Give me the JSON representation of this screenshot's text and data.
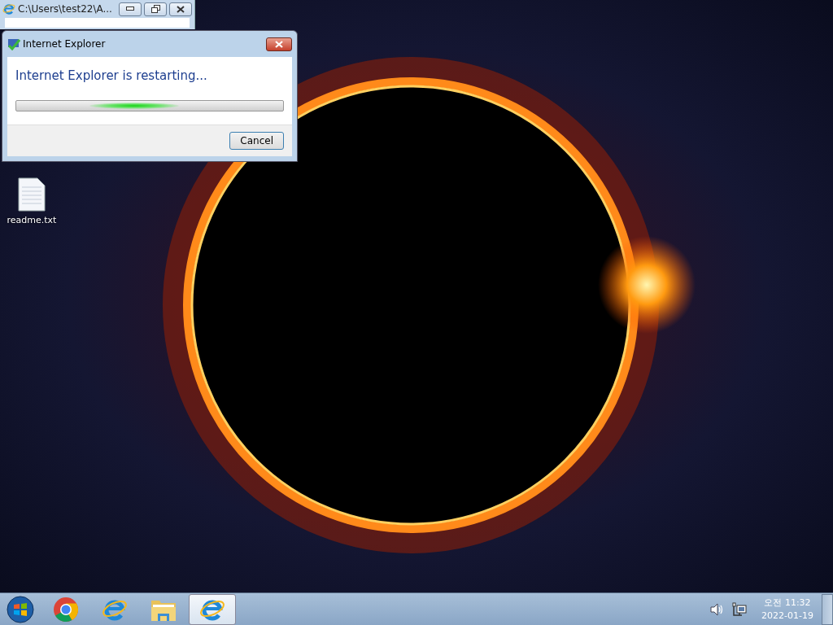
{
  "background_window": {
    "title": "C:\\Users\\test22\\A..."
  },
  "dialog": {
    "title": "Internet Explorer",
    "message": "Internet Explorer is restarting...",
    "indeterminate": true,
    "buttons": [
      "Cancel"
    ]
  },
  "desktop_icons": [
    {
      "label": "readme.txt"
    }
  ],
  "taskbar": {
    "items": [
      {
        "kind": "start",
        "selected": false
      },
      {
        "kind": "chrome",
        "selected": false
      },
      {
        "kind": "ie",
        "selected": false
      },
      {
        "kind": "folder",
        "selected": false
      },
      {
        "kind": "ie",
        "selected": true
      }
    ]
  },
  "tray": {
    "time": "오전 11:32",
    "date": "2022-01-19"
  }
}
